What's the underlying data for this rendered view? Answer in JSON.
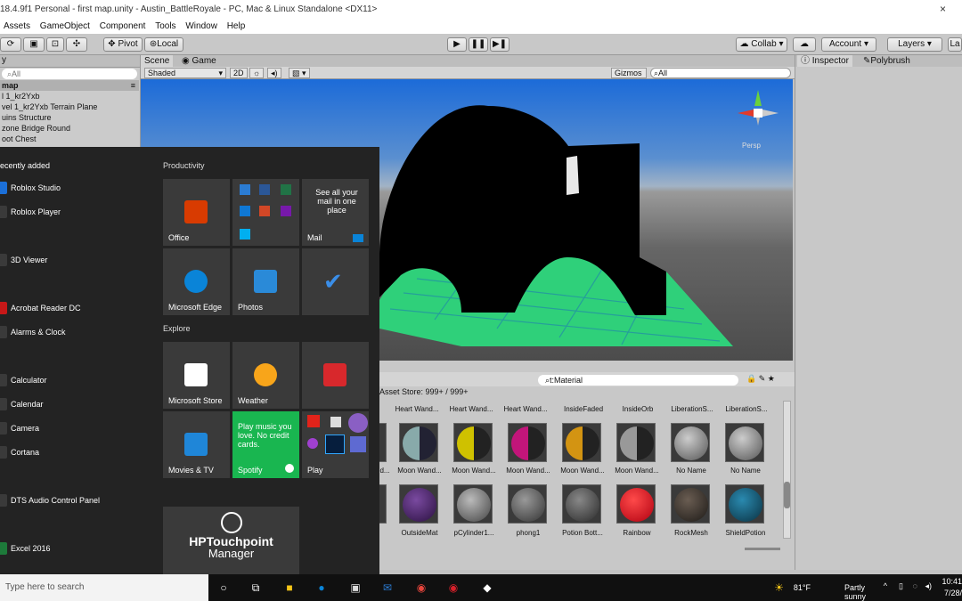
{
  "window": {
    "title": "18.4.9f1 Personal - first map.unity - Austin_BattleRoyale - PC, Mac & Linux Standalone <DX11>",
    "close": "×"
  },
  "menu": [
    "Assets",
    "GameObject",
    "Component",
    "Tools",
    "Window",
    "Help"
  ],
  "toolbar": {
    "pivot": "Pivot",
    "local": "Local",
    "collab": "Collab",
    "account": "Account",
    "layers": "Layers",
    "layout": "La"
  },
  "hierarchy": {
    "tab": "y",
    "search_placeholder": "All",
    "scene_name": "map",
    "items": [
      "l 1_kr2Yxb",
      "vel 1_kr2Yxb Terrain Plane",
      "uins Structure",
      "zone Bridge Round",
      "oot Chest"
    ]
  },
  "scene": {
    "tabs": [
      "Scene",
      "Game"
    ],
    "shading": "Shaded",
    "mode_2d": "2D",
    "gizmos": "Gizmos",
    "search_placeholder": "All",
    "persp_label": "Persp"
  },
  "inspector": {
    "tabs": [
      "Inspector",
      "Polybrush"
    ]
  },
  "project": {
    "search_value": "t:Material",
    "store_label": "Asset Store: 999+ / 999+",
    "row1_labels": [
      "Heart Wand...",
      "Heart Wand...",
      "Heart Wand...",
      "InsideFaded",
      "InsideOrb",
      "LiberationS...",
      "LiberationS..."
    ],
    "row2_labels": [
      "d...",
      "Moon Wand...",
      "Moon Wand...",
      "Moon Wand...",
      "Moon Wand...",
      "Moon Wand...",
      "No Name",
      "No Name"
    ],
    "row3_labels": [
      "",
      "OutsideMat",
      "pCylinder1...",
      "phong1",
      "Potion Bott...",
      "Rainbow",
      "RockMesh",
      "ShieldPotion"
    ]
  },
  "start_menu": {
    "recently_added": "ecently added",
    "apps": [
      "Roblox Studio",
      "Roblox Player",
      "3D Viewer",
      "Acrobat Reader DC",
      "Alarms & Clock",
      "Calculator",
      "Calendar",
      "Camera",
      "Cortana",
      "DTS Audio Control Panel",
      "Excel 2016"
    ],
    "groups": {
      "productivity": "Productivity",
      "explore": "Explore"
    },
    "tiles": {
      "office": "Office",
      "mail": "Mail",
      "mail_note": "See all your mail in one place",
      "edge": "Microsoft Edge",
      "photos": "Photos",
      "store": "Microsoft Store",
      "weather": "Weather",
      "movies": "Movies & TV",
      "spotify": "Spotify",
      "spotify_note": "Play music you love. No credit cards.",
      "play": "Play"
    },
    "hp_line1": "HPTouchpoint",
    "hp_line2": "Manager"
  },
  "taskbar": {
    "search_placeholder": "Type here to search",
    "temperature": "81°F",
    "weather": "Partly sunny",
    "time": "10:41",
    "date": "7/28/"
  },
  "colors": {
    "accent_green": "#19b650",
    "edge_blue": "#0a84d8",
    "unity_gray": "#c8c8c8",
    "terrain_green": "#3ad07a"
  }
}
